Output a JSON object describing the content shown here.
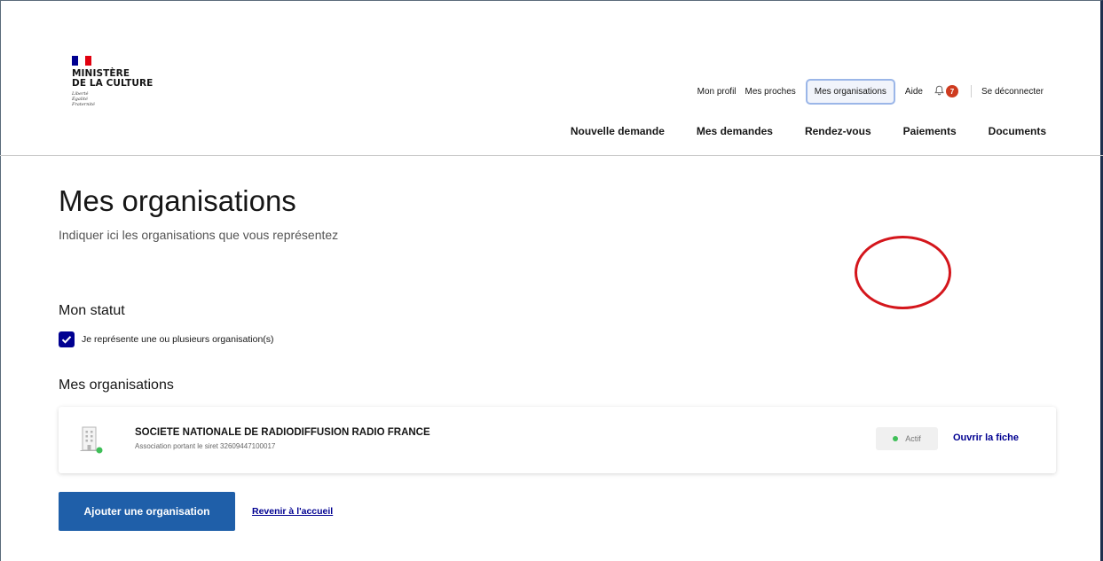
{
  "colors": {
    "flag_blue": "#000091",
    "flag_white": "#ffffff",
    "flag_red": "#e1000f",
    "primary_button": "#1f5fa9",
    "link": "#000091",
    "annotation_circle": "#d4161c",
    "status_dot": "#3fbf58",
    "badge": "#ce3b1f"
  },
  "logo": {
    "line1": "MINISTÈRE",
    "line2": "DE LA CULTURE",
    "motto1": "Liberté",
    "motto2": "Égalité",
    "motto3": "Fraternité"
  },
  "topnav": {
    "profile": "Mon profil",
    "relatives": "Mes proches",
    "organisations": "Mes organisations",
    "help": "Aide",
    "bell_icon": "bell-icon",
    "notifications_count": "7",
    "logout": "Se déconnecter"
  },
  "mainnav": {
    "new_request": "Nouvelle demande",
    "my_requests": "Mes demandes",
    "appointments": "Rendez-vous",
    "payments": "Paiements",
    "documents": "Documents"
  },
  "page": {
    "title": "Mes organisations",
    "subtitle": "Indiquer ici les organisations que vous représentez"
  },
  "status": {
    "title": "Mon statut",
    "checkbox_label": "Je représente une ou plusieurs organisation(s)",
    "checked": true
  },
  "organisations": {
    "title": "Mes organisations",
    "items": [
      {
        "name": "SOCIETE NATIONALE DE RADIODIFFUSION RADIO FRANCE",
        "description": "Association portant le siret 32609447100017",
        "status": "Actif",
        "action": "Ouvrir la fiche"
      }
    ]
  },
  "actions": {
    "add": "Ajouter une organisation",
    "back": "Revenir à l'accueil"
  }
}
